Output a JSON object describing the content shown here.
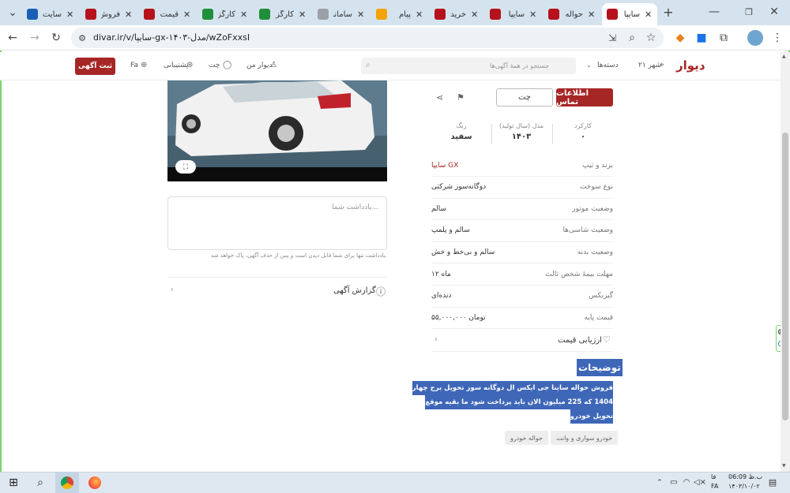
{
  "browser": {
    "tabs": [
      {
        "label": "سایت",
        "color": "#1a5fb4"
      },
      {
        "label": "فروش",
        "color": "#b5121b"
      },
      {
        "label": "قیمت",
        "color": "#b5121b"
      },
      {
        "label": "کارگزار",
        "color": "#1f8f3a"
      },
      {
        "label": "کارگز",
        "color": "#1f8f3a"
      },
      {
        "label": "سامانه",
        "color": "#9aa0a6"
      },
      {
        "label": "پیام",
        "color": "#f4a200"
      },
      {
        "label": "خرید",
        "color": "#b5121b"
      },
      {
        "label": "سایپا",
        "color": "#b5121b"
      },
      {
        "label": "حواله",
        "color": "#b5121b"
      },
      {
        "label": "سایپا",
        "color": "#b5121b",
        "active": true
      }
    ],
    "new_tab": "+",
    "url": "divar.ir/v/سایپا-gx-۱۴۰۳-مدل/wZoFxxsI"
  },
  "header": {
    "logo": "دیوار",
    "city": "۲۱ شهر",
    "categories": "دسته‌ها",
    "search_placeholder": "جستجو در همهٔ آگهی‌ها",
    "my_divar": "دیوار من",
    "chat": "چت",
    "support": "پشتیبانی",
    "lang": "Fa",
    "post_ad": "ثبت آگهی"
  },
  "left": {
    "note_placeholder": "یادداشت شما...",
    "note_hint": "یادداشت تنها برای شما قابل دیدن است و پس از حذف آگهی، پاک خواهد شد.",
    "report": "گزارش آگهی"
  },
  "right": {
    "contact": "اطلاعات تماس",
    "chat": "چت",
    "specs": [
      {
        "label": "کارکرد",
        "value": "۰"
      },
      {
        "label": "مدل (سال تولید)",
        "value": "۱۴۰۳"
      },
      {
        "label": "رنگ",
        "value": "سفید"
      }
    ],
    "rows": [
      {
        "label": "برند و تیپ",
        "value": "سایپا GX",
        "accent": true
      },
      {
        "label": "نوع سوخت",
        "value": "دوگانه‌سوز شرکتی"
      },
      {
        "label": "وضعیت موتور",
        "value": "سالم"
      },
      {
        "label": "وضعیت شاسی‌ها",
        "value": "سالم و پلمپ"
      },
      {
        "label": "وضعیت بدنه",
        "value": "سالم و بی‌خط و خش"
      },
      {
        "label": "مهلت بیمهٔ شخص ثالث",
        "value": "۱۲ ماه"
      },
      {
        "label": "گیربکس",
        "value": "دنده‌ای"
      },
      {
        "label": "قیمت پایه",
        "value": "۵۵,۰۰۰,۰۰۰ تومان"
      }
    ],
    "price_eval": "ارزیابی قیمت",
    "desc_title": "توضیحات",
    "desc_lines": [
      "فروش حواله ساینا جی ایکس ال دوگانه سوز تحویل برج چهار",
      "1404 که 225 میلیون الان باید پرداخت شود ما بقیه موقع",
      "تحویل خودرو"
    ],
    "tags": [
      "خودرو سواری و وانت",
      "حواله خودرو"
    ]
  },
  "taskbar": {
    "time": "06:09 ب.ظ",
    "date": "۱۴۰۳/۱۰/۰۲",
    "lang": "فا",
    "lang2": "FA"
  },
  "colors": {
    "accent": "#a62626",
    "highlight": "#3f67b8"
  }
}
